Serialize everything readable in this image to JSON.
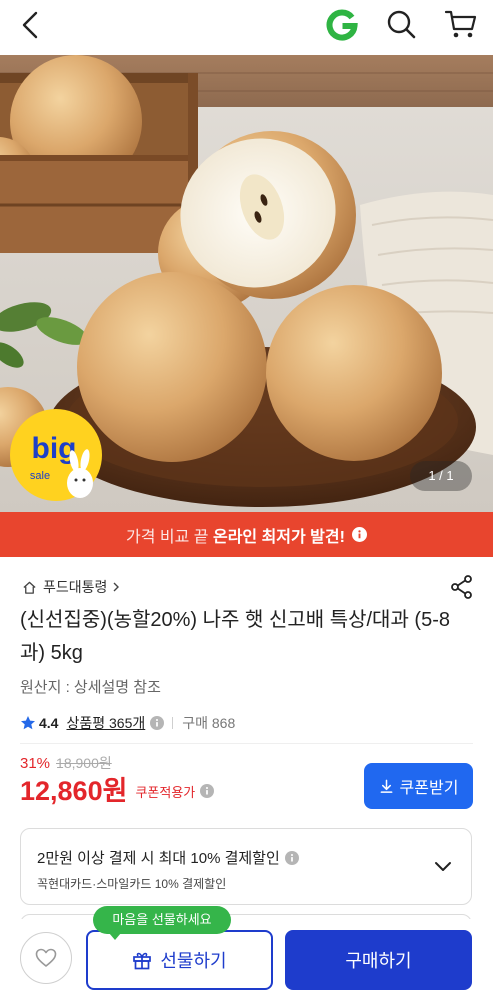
{
  "header": {
    "back_icon": "chevron-left-icon",
    "logo_icon": "gmarket-logo",
    "search_icon": "search-icon",
    "cart_icon": "cart-icon"
  },
  "gallery": {
    "counter": "1 / 1",
    "badge_big": "big",
    "badge_sale": "sale"
  },
  "promo_banner": {
    "prefix": "가격 비교 끝 ",
    "highlight": "온라인 최저가 발견!",
    "icon": "info-icon"
  },
  "product": {
    "store_icon": "home-icon",
    "store_name": "푸드대통령",
    "share_icon": "share-icon",
    "title": "(신선집중)(농할20%) 나주 햇 신고배 특상/대과 (5-8과) 5kg",
    "origin": "원산지 : 상세설명 참조",
    "rating": {
      "star_icon": "star-icon",
      "score": "4.4",
      "reviews_label": "상품평 365개",
      "purchases_label": "구매 868"
    },
    "price": {
      "discount": "31%",
      "original": "18,900원",
      "final": "12,860원",
      "coupon_note": "쿠폰적용가"
    },
    "coupon_button": {
      "label": "쿠폰받기",
      "icon": "download-icon"
    }
  },
  "payment_benefit": {
    "headline": "2만원 이상 결제 시 최대 10% 결제할인",
    "detail": "꼭현대카드·스마일카드 10% 결제할인",
    "expand_icon": "chevron-down-icon"
  },
  "bottom_bar": {
    "wishlist_icon": "heart-icon",
    "gift_tooltip": "마음을 선물하세요",
    "gift_icon": "gift-icon",
    "gift_label": "선물하기",
    "buy_label": "구매하기"
  },
  "colors": {
    "logo_green": "#2fb443",
    "banner_red": "#e8452e",
    "price_red": "#e3262b",
    "coupon_blue": "#2068f0",
    "buy_blue": "#1e3ccc",
    "tooltip_green": "#35b54a",
    "star_blue": "#2569e8"
  }
}
